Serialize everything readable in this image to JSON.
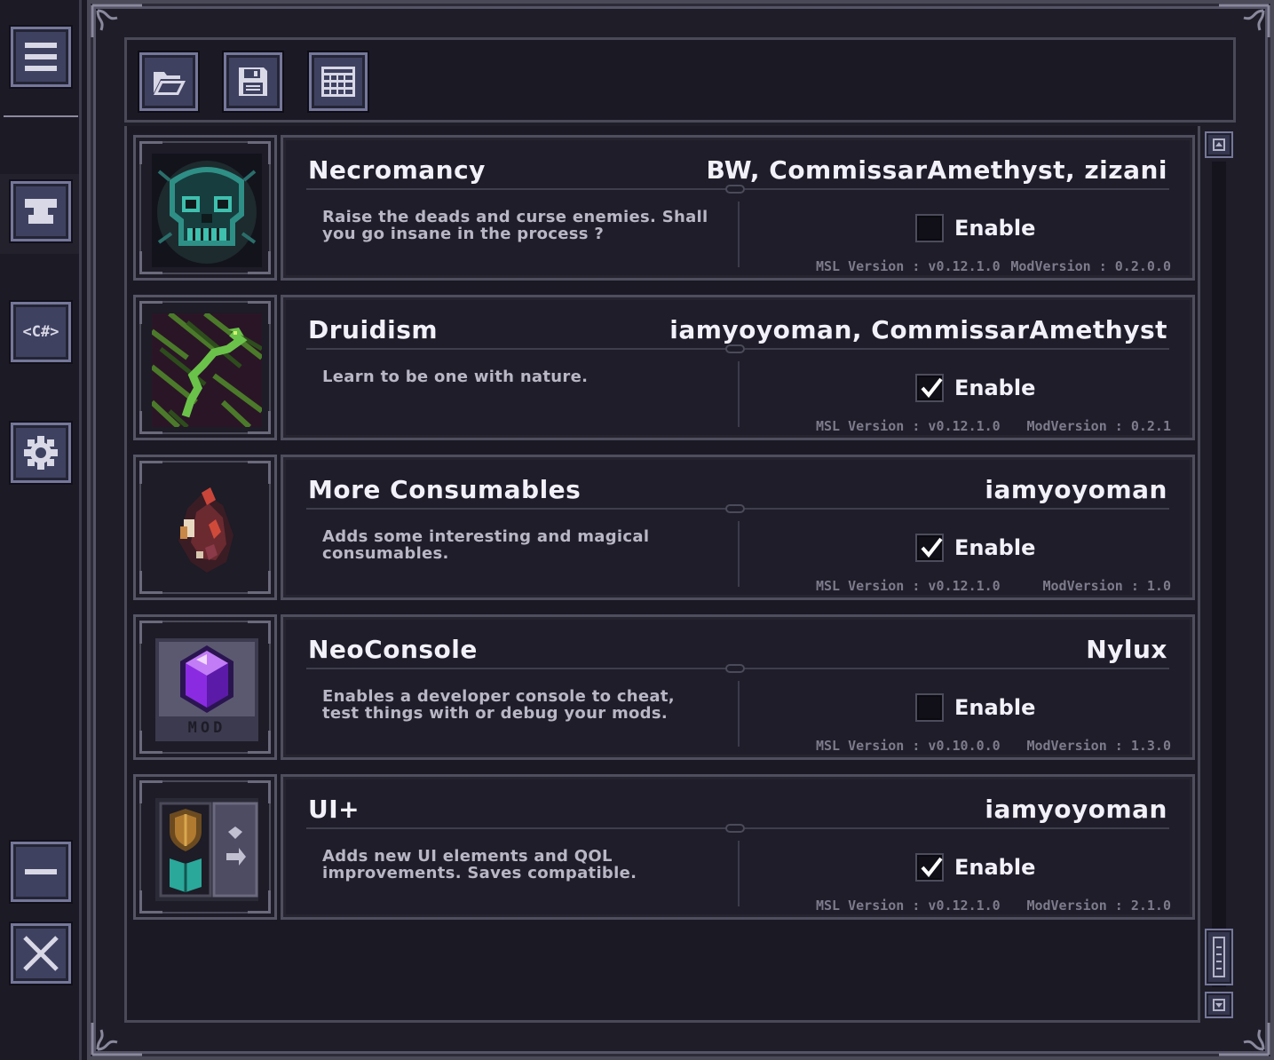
{
  "sidebar": {
    "buttons": [
      {
        "name": "menu",
        "icon": "hamburger-menu-icon"
      },
      {
        "name": "anvil",
        "icon": "anvil-icon"
      },
      {
        "name": "csharp",
        "icon": "csharp-code-icon",
        "label": "<C#>"
      },
      {
        "name": "settings",
        "icon": "gear-icon"
      },
      {
        "name": "minimize",
        "icon": "minimize-icon"
      },
      {
        "name": "close",
        "icon": "close-icon"
      }
    ]
  },
  "toolbar": {
    "buttons": [
      {
        "name": "open",
        "icon": "folder-open-icon"
      },
      {
        "name": "save",
        "icon": "floppy-save-icon"
      },
      {
        "name": "grid",
        "icon": "grid-icon"
      }
    ]
  },
  "mods": [
    {
      "name": "Necromancy",
      "authors": "BW, CommissarAmethyst, zizani",
      "description": "Raise the deads and curse enemies. Shall you go insane in the process ?",
      "enabled": false,
      "enable_label": "Enable",
      "msl_version": "MSL Version : v0.12.1.0",
      "mod_version": "ModVersion : 0.2.0.0",
      "icon": "skull-icon"
    },
    {
      "name": "Druidism",
      "authors": "iamyoyoman, CommissarAmethyst",
      "description": "Learn to be one with nature.",
      "enabled": true,
      "enable_label": "Enable",
      "msl_version": "MSL Version : v0.12.1.0",
      "mod_version": "ModVersion : 0.2.1",
      "icon": "serpent-vine-icon"
    },
    {
      "name": "More Consumables",
      "authors": "iamyoyoman",
      "description": "Adds some interesting and magical consumables.",
      "enabled": true,
      "enable_label": "Enable",
      "msl_version": "MSL Version : v0.12.1.0",
      "mod_version": "ModVersion : 1.0",
      "icon": "potion-pouch-icon"
    },
    {
      "name": "NeoConsole",
      "authors": "Nylux",
      "description": "Enables a developer console to cheat, test things with or debug your mods.",
      "enabled": false,
      "enable_label": "Enable",
      "msl_version": "MSL Version : v0.10.0.0",
      "mod_version": "ModVersion : 1.3.0",
      "icon": "purple-gem-mod-icon",
      "icon_text": "MOD"
    },
    {
      "name": "UI+",
      "authors": "iamyoyoman",
      "description": "Adds new UI elements and QOL improvements. Saves compatible.",
      "enabled": true,
      "enable_label": "Enable",
      "msl_version": "MSL Version : v0.12.1.0",
      "mod_version": "ModVersion : 2.1.0",
      "icon": "shield-book-panel-icon"
    }
  ],
  "colors": {
    "background": "#1b1a24",
    "panel": "#1e1d29",
    "button": "#3f4161",
    "text": "#f2f0f8",
    "muted_text": "#7d7b8c"
  }
}
